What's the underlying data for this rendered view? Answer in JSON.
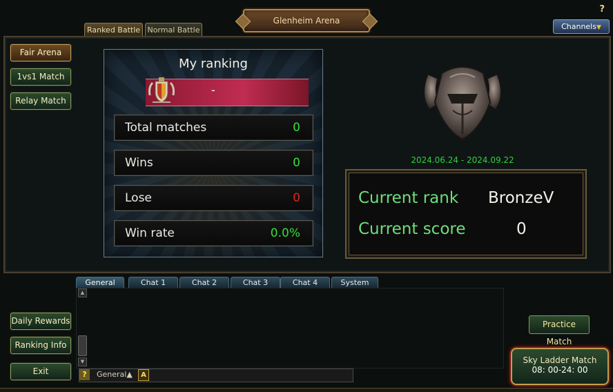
{
  "window": {
    "title": "Glenheim Arena",
    "help": "?"
  },
  "header": {
    "channels_label": "Channels"
  },
  "top_tabs": [
    {
      "label": "Ranked Battle",
      "active": true
    },
    {
      "label": "Normal Battle",
      "active": false
    }
  ],
  "sidebar": {
    "items": [
      {
        "label": "Fair Arena",
        "active": true
      },
      {
        "label": "1vs1 Match"
      },
      {
        "label": "Relay Match"
      }
    ]
  },
  "ranking": {
    "title": "My ranking",
    "rank_value": "-",
    "stats": [
      {
        "label": "Total matches",
        "value": "0",
        "color": "#34e03a"
      },
      {
        "label": "Wins",
        "value": "0",
        "color": "#34e03a"
      },
      {
        "label": "Lose",
        "value": "0",
        "color": "#e02424"
      },
      {
        "label": "Win rate",
        "value": "0.0%",
        "color": "#34e03a"
      }
    ]
  },
  "season": {
    "range": "2024.06.24 - 2024.09.22"
  },
  "current": {
    "rank_label": "Current rank",
    "rank_value": "BronzeV",
    "score_label": "Current score",
    "score_value": "0"
  },
  "chat": {
    "tabs": [
      "General",
      "Chat 1",
      "Chat 2",
      "Chat 3",
      "Chat 4",
      "System"
    ],
    "active_tab": "General",
    "input_help": "?",
    "channel": "General▲",
    "mode": "A"
  },
  "bottom_left": {
    "daily_rewards": "Daily Rewards",
    "ranking_info": "Ranking Info",
    "exit": "Exit"
  },
  "actions": {
    "practice": "Practice Match",
    "sky_ladder_label": "Sky Ladder Match",
    "sky_ladder_time": "08: 00-24: 00"
  },
  "colors": {
    "accent_green": "#34e03a",
    "accent_red": "#e02424",
    "gold": "#c0a050"
  }
}
